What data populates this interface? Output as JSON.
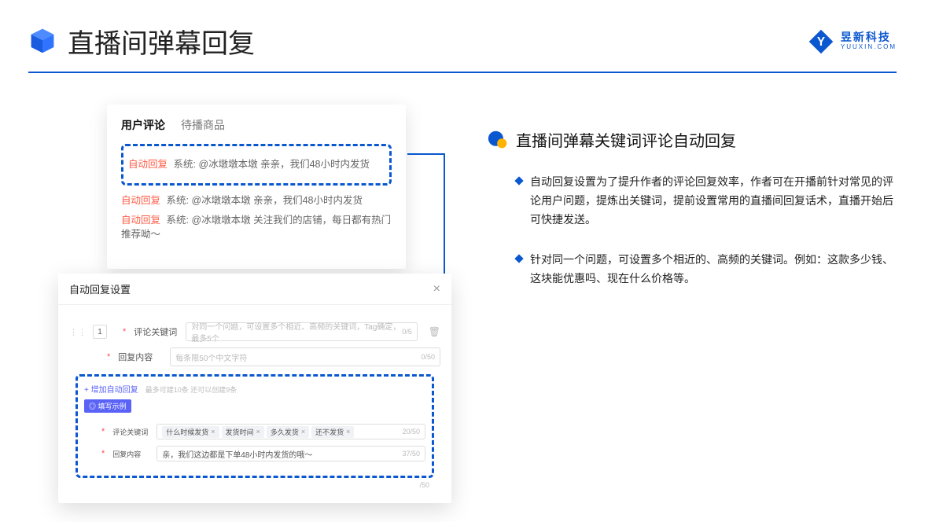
{
  "header": {
    "title": "直播间弹幕回复",
    "brand_cn": "昱新科技",
    "brand_en": "YUUXIN.COM"
  },
  "comments_card": {
    "tab_active": "用户评论",
    "tab_inactive": "待播商品",
    "highlighted": {
      "label": "自动回复",
      "text": "系统: @冰墩墩本墩 亲亲，我们48小时内发货"
    },
    "line2_label": "自动回复",
    "line2_text": "系统: @冰墩墩本墩 亲亲，我们48小时内发货",
    "line3_label": "自动回复",
    "line3_text": "系统: @冰墩墩本墩 关注我们的店铺，每日都有热门推荐呦～"
  },
  "settings": {
    "title": "自动回复设置",
    "idx": "1",
    "row1_label": "评论关键词",
    "row1_placeholder": "对同一个问题，可设置多个相近、高频的关键词，Tag确定，最多5个",
    "row1_count": "0/5",
    "row2_label": "回复内容",
    "row2_placeholder": "每条限50个中文字符",
    "row2_count": "0/50",
    "add_link": "+ 增加自动回复",
    "add_hint": "最多可建10条 还可以创建9条",
    "example_chip": "◎ 填写示例",
    "ex_row1_label": "评论关键词",
    "ex_tags": [
      "什么时候发货",
      "发货时间",
      "多久发货",
      "还不发货"
    ],
    "ex_row1_count": "20/50",
    "ex_row2_label": "回复内容",
    "ex_row2_text": "亲，我们这边都是下单48小时内发货的哦～",
    "ex_row2_count": "37/50",
    "outer_count": "/50"
  },
  "right": {
    "section_title": "直播间弹幕关键词评论自动回复",
    "bullet1": "自动回复设置为了提升作者的评论回复效率，作者可在开播前针对常见的评论用户问题，提炼出关键词，提前设置常用的直播间回复话术，直播开始后可快捷发送。",
    "bullet2": "针对同一个问题，可设置多个相近的、高频的关键词。例如：这款多少钱、这块能优惠吗、现在什么价格等。"
  }
}
